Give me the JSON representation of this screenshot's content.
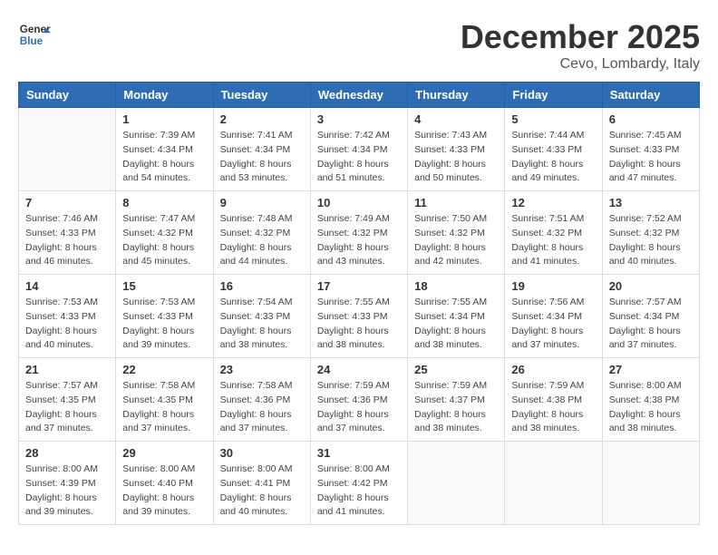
{
  "header": {
    "logo_line1": "General",
    "logo_line2": "Blue",
    "title": "December 2025",
    "location": "Cevo, Lombardy, Italy"
  },
  "weekdays": [
    "Sunday",
    "Monday",
    "Tuesday",
    "Wednesday",
    "Thursday",
    "Friday",
    "Saturday"
  ],
  "weeks": [
    [
      {
        "day": "",
        "info": ""
      },
      {
        "day": "1",
        "info": "Sunrise: 7:39 AM\nSunset: 4:34 PM\nDaylight: 8 hours\nand 54 minutes."
      },
      {
        "day": "2",
        "info": "Sunrise: 7:41 AM\nSunset: 4:34 PM\nDaylight: 8 hours\nand 53 minutes."
      },
      {
        "day": "3",
        "info": "Sunrise: 7:42 AM\nSunset: 4:34 PM\nDaylight: 8 hours\nand 51 minutes."
      },
      {
        "day": "4",
        "info": "Sunrise: 7:43 AM\nSunset: 4:33 PM\nDaylight: 8 hours\nand 50 minutes."
      },
      {
        "day": "5",
        "info": "Sunrise: 7:44 AM\nSunset: 4:33 PM\nDaylight: 8 hours\nand 49 minutes."
      },
      {
        "day": "6",
        "info": "Sunrise: 7:45 AM\nSunset: 4:33 PM\nDaylight: 8 hours\nand 47 minutes."
      }
    ],
    [
      {
        "day": "7",
        "info": "Sunrise: 7:46 AM\nSunset: 4:33 PM\nDaylight: 8 hours\nand 46 minutes."
      },
      {
        "day": "8",
        "info": "Sunrise: 7:47 AM\nSunset: 4:32 PM\nDaylight: 8 hours\nand 45 minutes."
      },
      {
        "day": "9",
        "info": "Sunrise: 7:48 AM\nSunset: 4:32 PM\nDaylight: 8 hours\nand 44 minutes."
      },
      {
        "day": "10",
        "info": "Sunrise: 7:49 AM\nSunset: 4:32 PM\nDaylight: 8 hours\nand 43 minutes."
      },
      {
        "day": "11",
        "info": "Sunrise: 7:50 AM\nSunset: 4:32 PM\nDaylight: 8 hours\nand 42 minutes."
      },
      {
        "day": "12",
        "info": "Sunrise: 7:51 AM\nSunset: 4:32 PM\nDaylight: 8 hours\nand 41 minutes."
      },
      {
        "day": "13",
        "info": "Sunrise: 7:52 AM\nSunset: 4:32 PM\nDaylight: 8 hours\nand 40 minutes."
      }
    ],
    [
      {
        "day": "14",
        "info": "Sunrise: 7:53 AM\nSunset: 4:33 PM\nDaylight: 8 hours\nand 40 minutes."
      },
      {
        "day": "15",
        "info": "Sunrise: 7:53 AM\nSunset: 4:33 PM\nDaylight: 8 hours\nand 39 minutes."
      },
      {
        "day": "16",
        "info": "Sunrise: 7:54 AM\nSunset: 4:33 PM\nDaylight: 8 hours\nand 38 minutes."
      },
      {
        "day": "17",
        "info": "Sunrise: 7:55 AM\nSunset: 4:33 PM\nDaylight: 8 hours\nand 38 minutes."
      },
      {
        "day": "18",
        "info": "Sunrise: 7:55 AM\nSunset: 4:34 PM\nDaylight: 8 hours\nand 38 minutes."
      },
      {
        "day": "19",
        "info": "Sunrise: 7:56 AM\nSunset: 4:34 PM\nDaylight: 8 hours\nand 37 minutes."
      },
      {
        "day": "20",
        "info": "Sunrise: 7:57 AM\nSunset: 4:34 PM\nDaylight: 8 hours\nand 37 minutes."
      }
    ],
    [
      {
        "day": "21",
        "info": "Sunrise: 7:57 AM\nSunset: 4:35 PM\nDaylight: 8 hours\nand 37 minutes."
      },
      {
        "day": "22",
        "info": "Sunrise: 7:58 AM\nSunset: 4:35 PM\nDaylight: 8 hours\nand 37 minutes."
      },
      {
        "day": "23",
        "info": "Sunrise: 7:58 AM\nSunset: 4:36 PM\nDaylight: 8 hours\nand 37 minutes."
      },
      {
        "day": "24",
        "info": "Sunrise: 7:59 AM\nSunset: 4:36 PM\nDaylight: 8 hours\nand 37 minutes."
      },
      {
        "day": "25",
        "info": "Sunrise: 7:59 AM\nSunset: 4:37 PM\nDaylight: 8 hours\nand 38 minutes."
      },
      {
        "day": "26",
        "info": "Sunrise: 7:59 AM\nSunset: 4:38 PM\nDaylight: 8 hours\nand 38 minutes."
      },
      {
        "day": "27",
        "info": "Sunrise: 8:00 AM\nSunset: 4:38 PM\nDaylight: 8 hours\nand 38 minutes."
      }
    ],
    [
      {
        "day": "28",
        "info": "Sunrise: 8:00 AM\nSunset: 4:39 PM\nDaylight: 8 hours\nand 39 minutes."
      },
      {
        "day": "29",
        "info": "Sunrise: 8:00 AM\nSunset: 4:40 PM\nDaylight: 8 hours\nand 39 minutes."
      },
      {
        "day": "30",
        "info": "Sunrise: 8:00 AM\nSunset: 4:41 PM\nDaylight: 8 hours\nand 40 minutes."
      },
      {
        "day": "31",
        "info": "Sunrise: 8:00 AM\nSunset: 4:42 PM\nDaylight: 8 hours\nand 41 minutes."
      },
      {
        "day": "",
        "info": ""
      },
      {
        "day": "",
        "info": ""
      },
      {
        "day": "",
        "info": ""
      }
    ]
  ]
}
